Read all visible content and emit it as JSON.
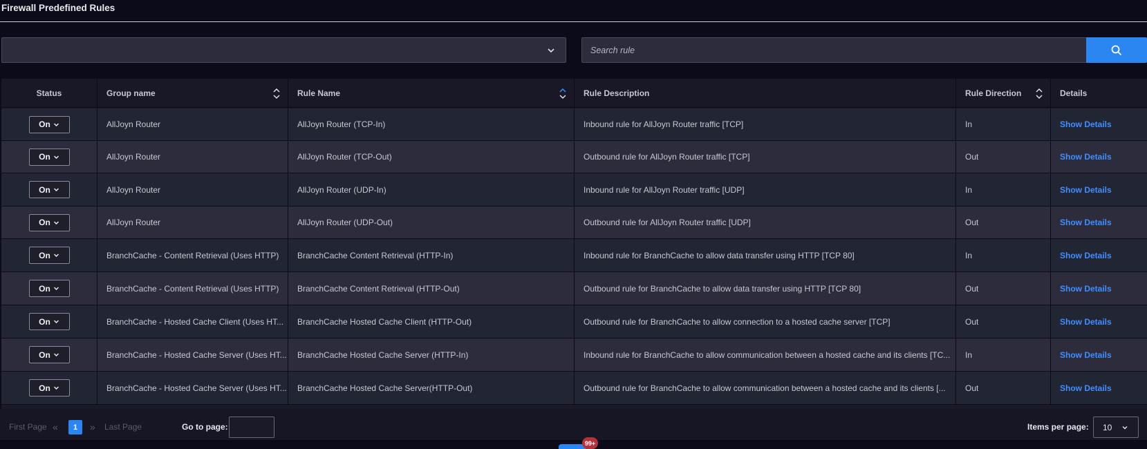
{
  "page_title": "Firewall Predefined Rules",
  "group_select": {
    "value": ""
  },
  "search": {
    "placeholder": "Search rule"
  },
  "table": {
    "columns": [
      "Status",
      "Group name",
      "Rule Name",
      "Rule Description",
      "Rule Direction",
      "Details"
    ],
    "rows": [
      {
        "status": "On",
        "group": "AllJoyn Router",
        "rule": "AllJoyn Router (TCP-In)",
        "description": "Inbound rule for AllJoyn Router traffic [TCP]",
        "direction": "In",
        "details": "Show Details"
      },
      {
        "status": "On",
        "group": "AllJoyn Router",
        "rule": "AllJoyn Router (TCP-Out)",
        "description": "Outbound rule for AllJoyn Router traffic [TCP]",
        "direction": "Out",
        "details": "Show Details"
      },
      {
        "status": "On",
        "group": "AllJoyn Router",
        "rule": "AllJoyn Router (UDP-In)",
        "description": "Inbound rule for AllJoyn Router traffic [UDP]",
        "direction": "In",
        "details": "Show Details"
      },
      {
        "status": "On",
        "group": "AllJoyn Router",
        "rule": "AllJoyn Router (UDP-Out)",
        "description": "Outbound rule for AllJoyn Router traffic [UDP]",
        "direction": "Out",
        "details": "Show Details"
      },
      {
        "status": "On",
        "group": "BranchCache - Content Retrieval (Uses HTTP)",
        "rule": "BranchCache Content Retrieval (HTTP-In)",
        "description": "Inbound rule for BranchCache to allow data transfer using HTTP [TCP 80]",
        "direction": "In",
        "details": "Show Details"
      },
      {
        "status": "On",
        "group": "BranchCache - Content Retrieval (Uses HTTP)",
        "rule": "BranchCache Content Retrieval (HTTP-Out)",
        "description": "Outbound rule for BranchCache to allow data transfer using HTTP [TCP 80]",
        "direction": "Out",
        "details": "Show Details"
      },
      {
        "status": "On",
        "group": "BranchCache - Hosted Cache Client (Uses HT...",
        "rule": "BranchCache Hosted Cache Client (HTTP-Out)",
        "description": "Outbound rule for BranchCache to allow connection to a hosted cache server [TCP]",
        "direction": "Out",
        "details": "Show Details"
      },
      {
        "status": "On",
        "group": "BranchCache - Hosted Cache Server (Uses HT...",
        "rule": "BranchCache Hosted Cache Server (HTTP-In)",
        "description": "Inbound rule for BranchCache to allow communication between a hosted cache and its clients [TC...",
        "direction": "In",
        "details": "Show Details"
      },
      {
        "status": "On",
        "group": "BranchCache - Hosted Cache Server (Uses HT...",
        "rule": "BranchCache Hosted Cache Server(HTTP-Out)",
        "description": "Outbound rule for BranchCache to allow communication between a hosted cache and its clients [...",
        "direction": "Out",
        "details": "Show Details"
      }
    ]
  },
  "pagination": {
    "first_label": "First Page",
    "last_label": "Last Page",
    "prev_glyph": "«",
    "next_glyph": "»",
    "current_page": "1",
    "goto_label": "Go to page:",
    "goto_value": "",
    "items_per_page_label": "Items per page:",
    "items_per_page_value": "10"
  },
  "notification_badge": "99+",
  "colors": {
    "accent": "#2b86f2",
    "link": "#3f8fff",
    "background": "#0b0b1a",
    "badge": "#b5323a"
  }
}
